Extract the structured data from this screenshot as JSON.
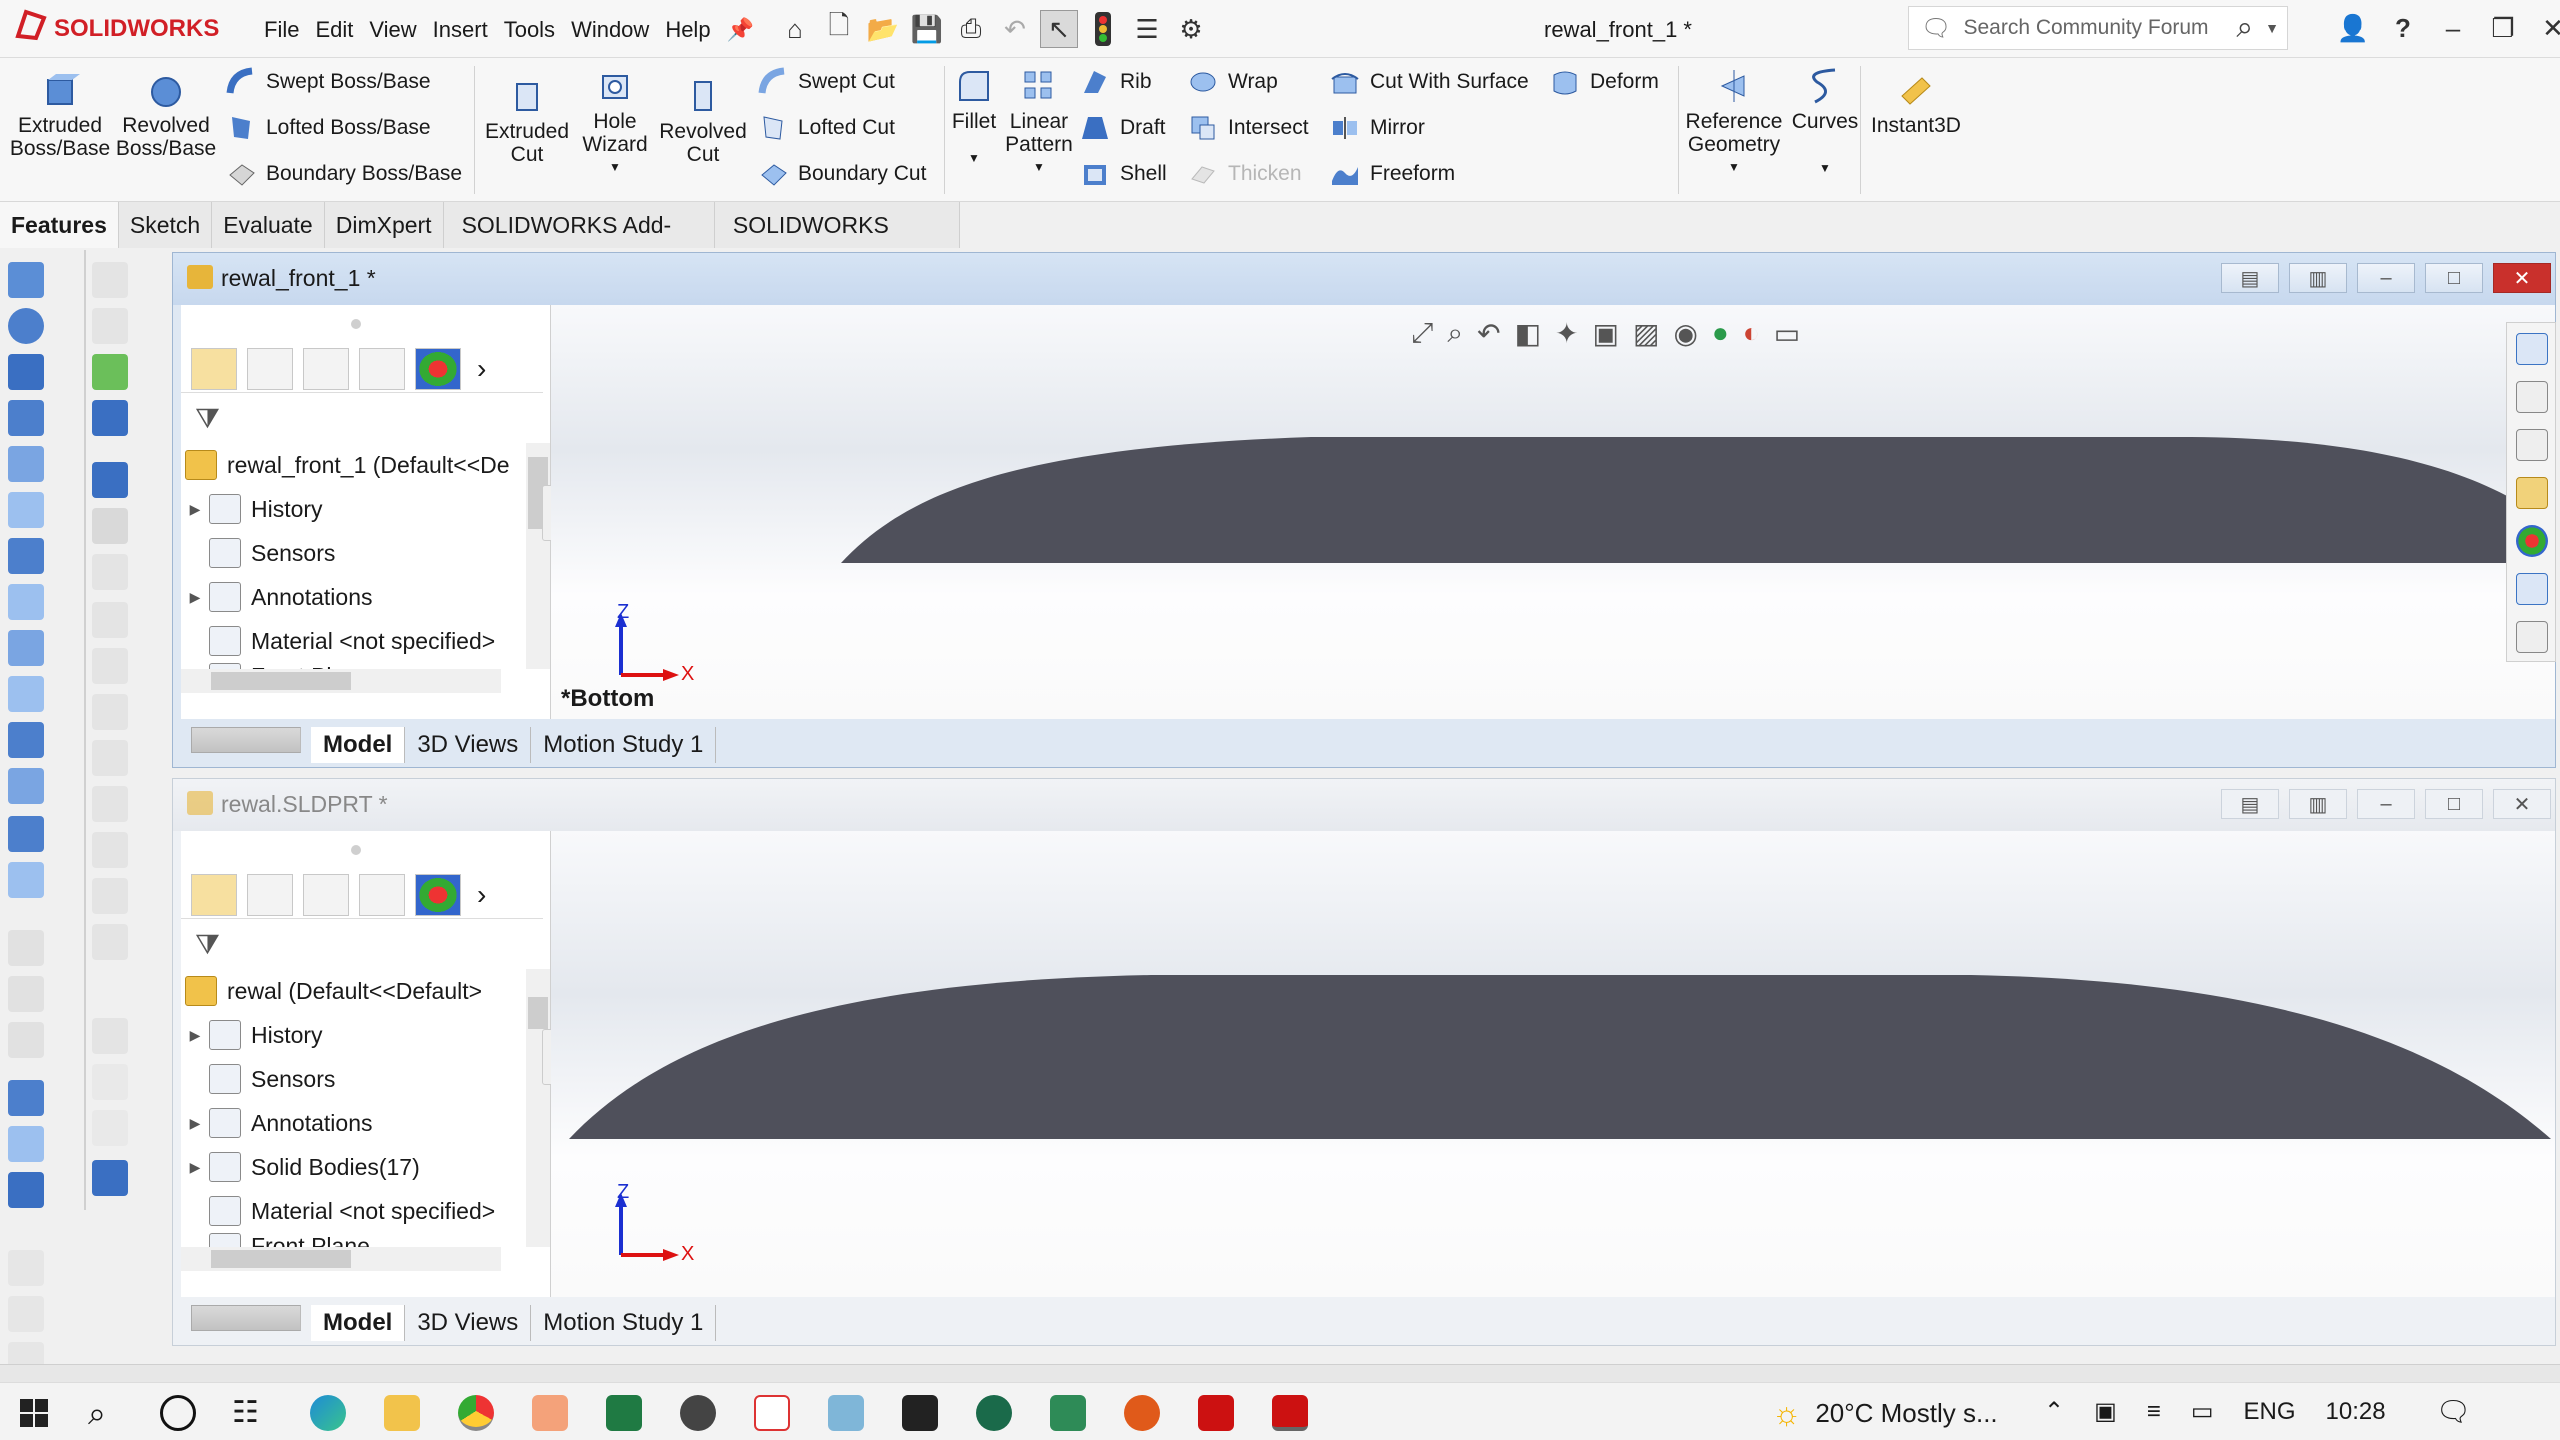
{
  "app": {
    "brand_ds": "3DS",
    "brand_name": "SOLIDWORKS"
  },
  "menu": [
    "File",
    "Edit",
    "View",
    "Insert",
    "Tools",
    "Window",
    "Help"
  ],
  "window_title": "rewal_front_1 *",
  "search": {
    "placeholder": "Search Community Forum"
  },
  "ribbon": {
    "extruded_boss": "Extruded\nBoss/Base",
    "revolved_boss": "Revolved\nBoss/Base",
    "swept_boss": "Swept Boss/Base",
    "lofted_boss": "Lofted Boss/Base",
    "boundary_boss": "Boundary Boss/Base",
    "extruded_cut": "Extruded\nCut",
    "hole_wizard": "Hole\nWizard",
    "revolved_cut": "Revolved\nCut",
    "swept_cut": "Swept Cut",
    "lofted_cut": "Lofted Cut",
    "boundary_cut": "Boundary Cut",
    "fillet": "Fillet",
    "linear_pattern": "Linear\nPattern",
    "rib": "Rib",
    "draft": "Draft",
    "shell": "Shell",
    "wrap": "Wrap",
    "intersect": "Intersect",
    "thicken": "Thicken",
    "cut_with_surface": "Cut With Surface",
    "mirror": "Mirror",
    "freeform": "Freeform",
    "deform": "Deform",
    "reference_geometry": "Reference\nGeometry",
    "curves": "Curves",
    "instant3d": "Instant3D"
  },
  "tabs": [
    "Features",
    "Sketch",
    "Evaluate",
    "DimXpert",
    "SOLIDWORKS Add-Ins",
    "SOLIDWORKS MBD"
  ],
  "doc1": {
    "title": "rewal_front_1 *",
    "root": "rewal_front_1  (Default<<De",
    "tree": [
      "History",
      "Sensors",
      "Annotations",
      "Material <not specified>",
      "Front Plane"
    ],
    "view_label": "*Bottom",
    "bottom_tabs": [
      "Model",
      "3D Views",
      "Motion Study 1"
    ]
  },
  "doc2": {
    "title": "rewal.SLDPRT *",
    "root": "rewal  (Default<<Default>",
    "tree": [
      "History",
      "Sensors",
      "Annotations",
      "Solid Bodies(17)",
      "Material <not specified>",
      "Front Plane"
    ],
    "bottom_tabs": [
      "Model",
      "3D Views",
      "Motion Study 1"
    ]
  },
  "triad": {
    "z": "Z",
    "x": "X"
  },
  "colors": {
    "part": "#4f505b",
    "brand": "#d11f26",
    "close": "#c9302c"
  },
  "taskbar": {
    "weather": "20°C  Mostly s...",
    "lang": "ENG",
    "time": "10:28"
  }
}
